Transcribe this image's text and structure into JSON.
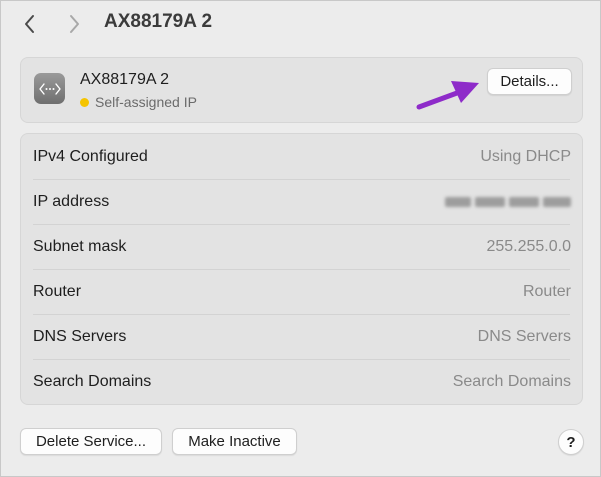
{
  "header": {
    "title": "AX88179A 2",
    "back_icon": "chevron-left-icon",
    "forward_icon": "chevron-right-icon"
  },
  "service": {
    "icon": "network-ethernet-icon",
    "name": "AX88179A 2",
    "status": "Self-assigned IP",
    "status_color": "#f5c400",
    "details_label": "Details..."
  },
  "annotation": {
    "arrow_color": "#8e2bc9"
  },
  "table": {
    "rows": [
      {
        "label": "IPv4 Configured",
        "value": "Using DHCP"
      },
      {
        "label": "IP address",
        "value": ""
      },
      {
        "label": "Subnet mask",
        "value": "255.255.0.0"
      },
      {
        "label": "Router",
        "value": "Router"
      },
      {
        "label": "DNS Servers",
        "value": "DNS Servers"
      },
      {
        "label": "Search Domains",
        "value": "Search Domains"
      }
    ]
  },
  "footer": {
    "delete_label": "Delete Service...",
    "inactive_label": "Make Inactive",
    "help_label": "?"
  }
}
